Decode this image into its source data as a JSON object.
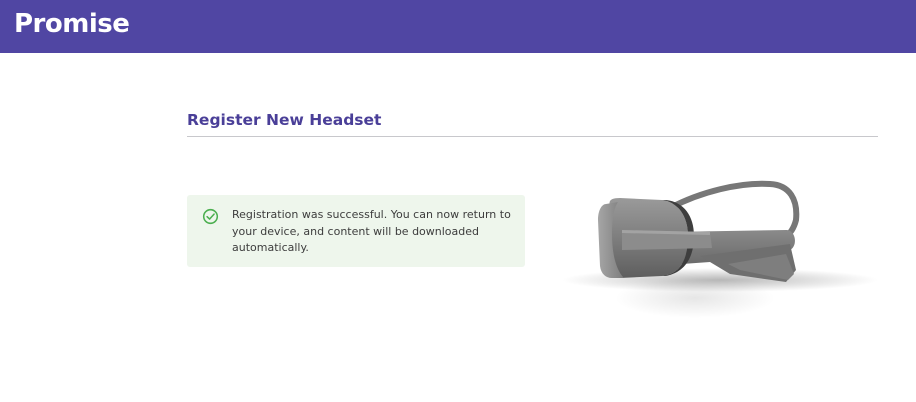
{
  "header": {
    "brand": "Promise",
    "background_color": "#5046a3"
  },
  "main": {
    "title": "Register New Headset",
    "alert": {
      "icon": "check-circle-icon",
      "message": "Registration was successful. You can now return to your device, and content will be downloaded automatically.",
      "background_color": "#eef6ec",
      "icon_color": "#4caf50"
    },
    "illustration": {
      "icon": "vr-headset-illustration"
    }
  }
}
